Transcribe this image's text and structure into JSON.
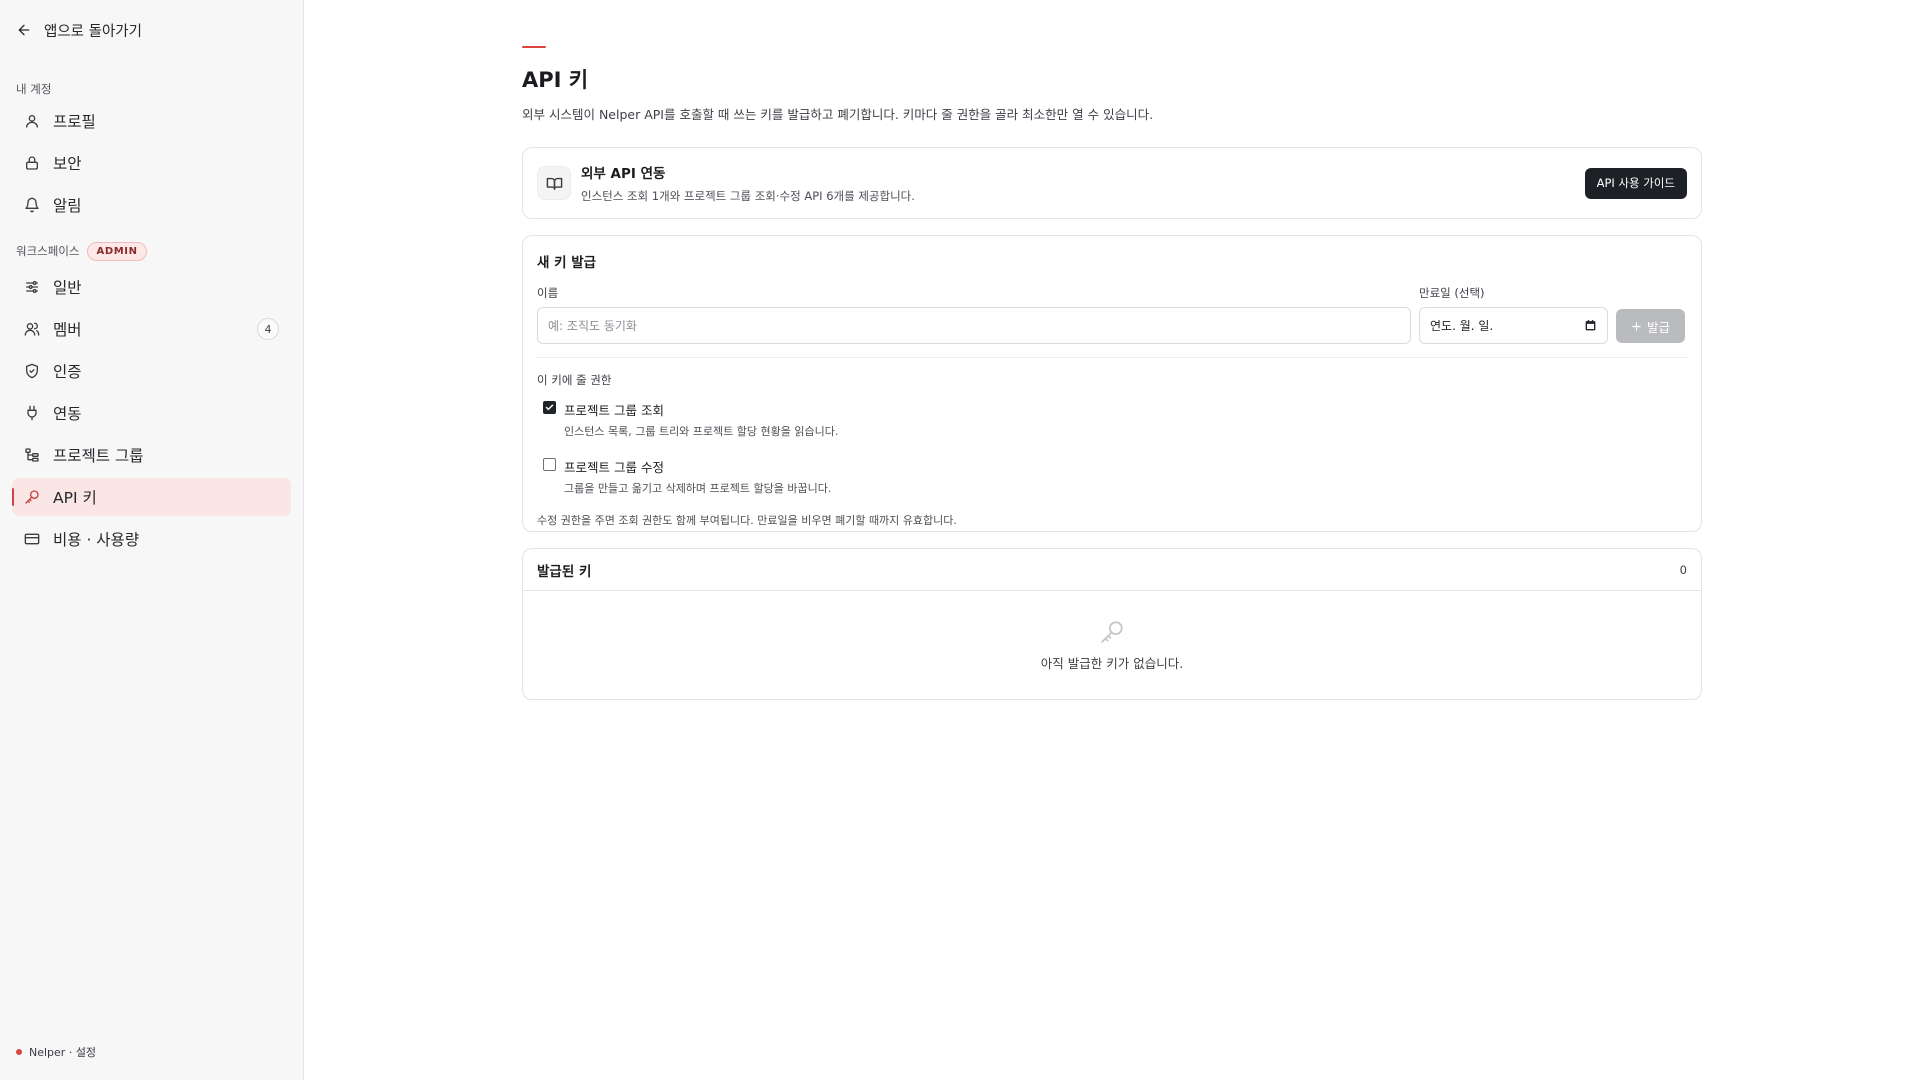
{
  "sidebar": {
    "back_label": "앱으로 돌아가기",
    "account_section": "내 계정",
    "account_items": [
      {
        "label": "프로필",
        "icon": "user-icon"
      },
      {
        "label": "보안",
        "icon": "lock-icon"
      },
      {
        "label": "알림",
        "icon": "bell-icon"
      }
    ],
    "workspace_section": "워크스페이스",
    "workspace_badge": "ADMIN",
    "workspace_items": [
      {
        "label": "일반",
        "icon": "sliders-icon"
      },
      {
        "label": "멤버",
        "icon": "users-icon",
        "count": "4"
      },
      {
        "label": "인증",
        "icon": "shield-check-icon"
      },
      {
        "label": "연동",
        "icon": "plug-icon"
      },
      {
        "label": "프로젝트 그룹",
        "icon": "tree-icon"
      },
      {
        "label": "API 키",
        "icon": "key-icon",
        "active": true
      },
      {
        "label": "비용 · 사용량",
        "icon": "credit-card-icon"
      }
    ],
    "footer": "Nelper · 설정"
  },
  "page": {
    "title": "API 키",
    "description": "외부 시스템이 Nelper API를 호출할 때 쓰는 키를 발급하고 폐기합니다. 키마다 줄 권한을 골라 최소한만 열 수 있습니다."
  },
  "api_card": {
    "title": "외부 API 연동",
    "description": "인스턴스 조회 1개와 프로젝트 그룹 조회·수정 API 6개를 제공합니다.",
    "button": "API 사용 가이드"
  },
  "new_key": {
    "title": "새 키 발급",
    "name_label": "이름",
    "name_placeholder": "예: 조직도 동기화",
    "expiry_label": "만료일 (선택)",
    "expiry_placeholder": "연도. 월. 일.",
    "issue_button": "발급",
    "permissions_label": "이 키에 줄 권한",
    "permissions": [
      {
        "title": "프로젝트 그룹 조회",
        "description": "인스턴스 목록, 그룹 트리와 프로젝트 할당 현황을 읽습니다.",
        "checked": true
      },
      {
        "title": "프로젝트 그룹 수정",
        "description": "그룹을 만들고 옮기고 삭제하며 프로젝트 할당을 바꿉니다.",
        "checked": false
      }
    ],
    "note": "수정 권한을 주면 조회 권한도 함께 부여됩니다. 만료일을 비우면 폐기할 때까지 유효합니다."
  },
  "issued_keys": {
    "title": "발급된 키",
    "count": "0",
    "empty_text": "아직 발급한 키가 없습니다."
  },
  "colors": {
    "accent": "#d9463f",
    "active_bg": "#fbe6e6",
    "dark_button": "#1d2125"
  }
}
